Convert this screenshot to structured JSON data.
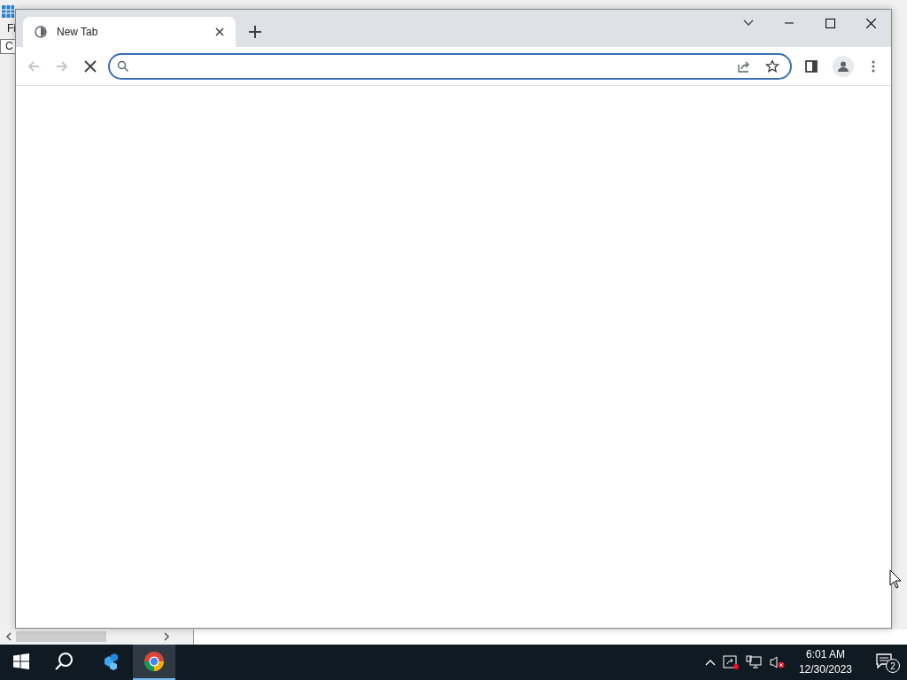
{
  "background_window": {
    "menu_text": "Fi",
    "address_text": "C"
  },
  "browser": {
    "tabs": [
      {
        "title": "New Tab",
        "selected": true
      }
    ],
    "back": {
      "disabled": true
    },
    "forward": {
      "disabled": true
    },
    "loading": true
  },
  "taskbar": {
    "apps": [
      {
        "kind": "registry",
        "selected": false
      },
      {
        "kind": "chrome",
        "selected": true
      }
    ],
    "time": "6:01 AM",
    "date": "12/30/2023",
    "notifications": "2"
  }
}
